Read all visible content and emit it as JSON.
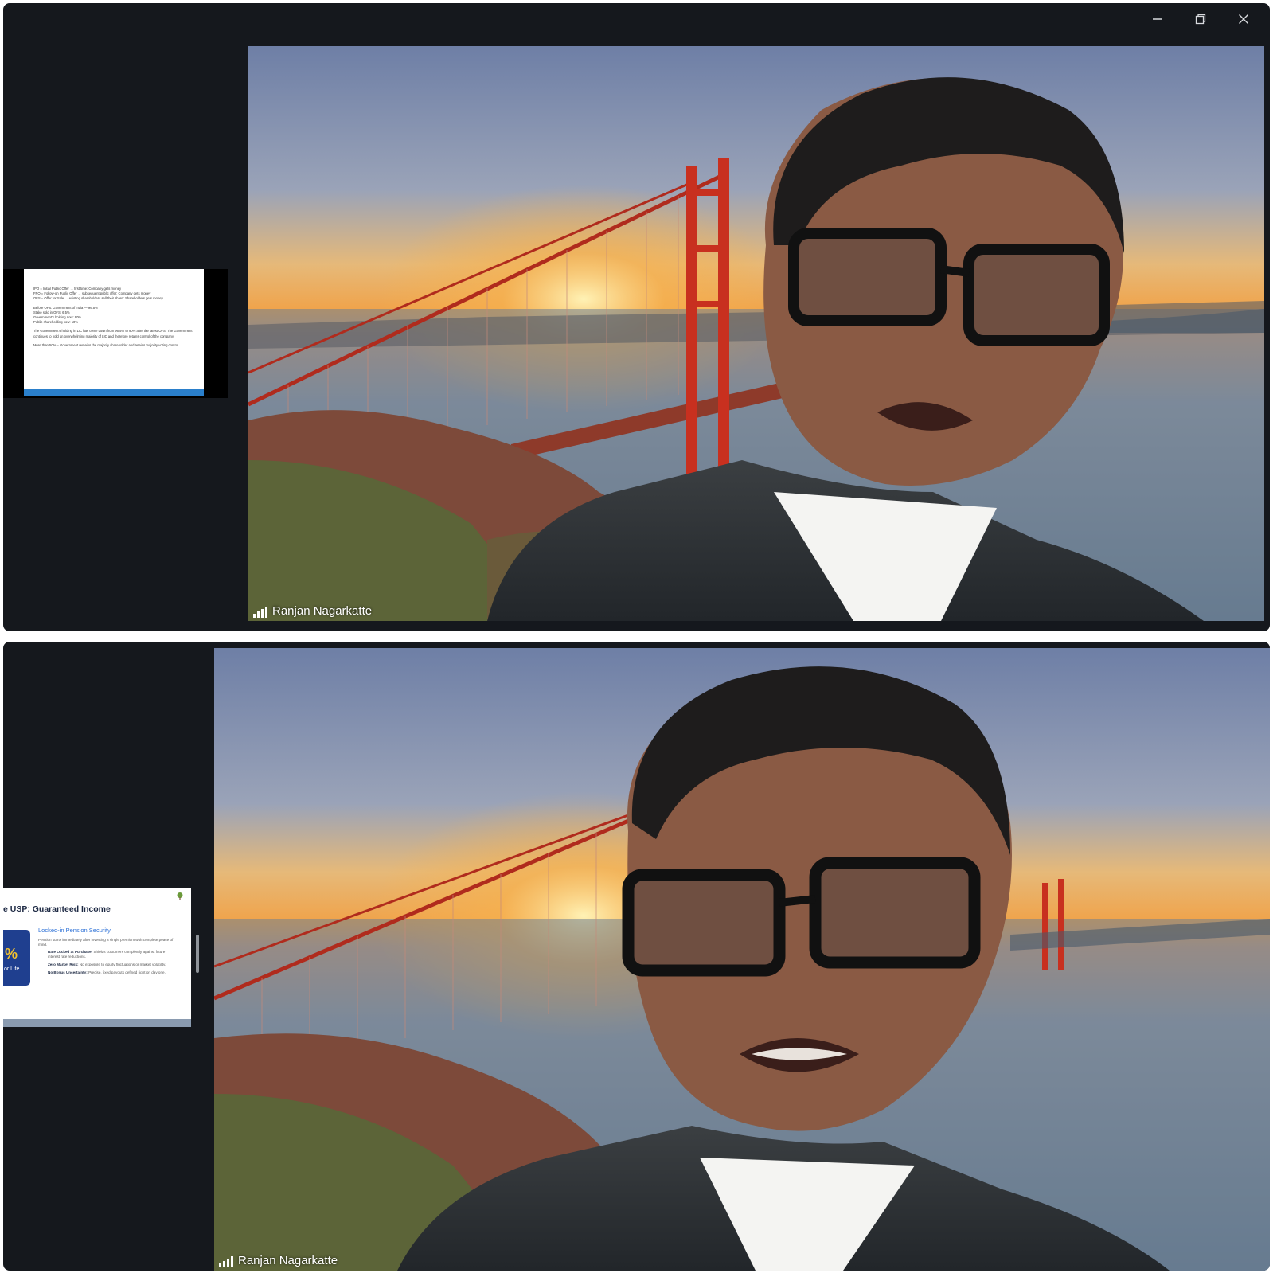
{
  "window_controls": {
    "minimize_icon": "minimize-icon",
    "restore_icon": "restore-icon",
    "close_icon": "close-icon"
  },
  "participant": {
    "name": "Ranjan Nagarkatte"
  },
  "slide1": {
    "lines": [
      "IPO = Initial Public Offer → first time: Company gets money",
      "FPO = Follow-on Public Offer → subsequent public offer: Company gets money",
      "OFS = Offer for Sale → existing shareholders sell their share: Shareholders gets money",
      "Before OFS: Government of India — 96.5%",
      "Stake sold in OFS: 6.5%",
      "Government's holding now: 90%",
      "Public shareholding now: 10%",
      "The Government's holding in LIC has come down from 96.5% to 90% after the latest OFS. The Government continues to hold an overwhelming majority of LIC and therefore retains control of the company.",
      "More than 50% = Government remains the majority shareholder and retains majority voting control."
    ]
  },
  "slide2": {
    "heading": "e USP: Guaranteed Income",
    "subheading": "Locked-in Pension Security",
    "tile_value": "%",
    "tile_caption": "or Life",
    "intro": "Pension starts immediately after investing a single premium with complete peace of mind.",
    "bullets": [
      {
        "title": "Rate Locked at Purchase:",
        "text": "Shields customers completely against future interest rate reductions."
      },
      {
        "title": "Zero Market Risk:",
        "text": "No exposure to equity fluctuations or market volatility."
      },
      {
        "title": "No Bonus Uncertainty:",
        "text": "Precise, fixed payouts defined right on day one."
      }
    ]
  },
  "colors": {
    "window_bg": "#15181d",
    "slide1_bar": "#2a7fcb",
    "slide2_tile": "#1f3f8f",
    "bridge": "#c8301f"
  }
}
